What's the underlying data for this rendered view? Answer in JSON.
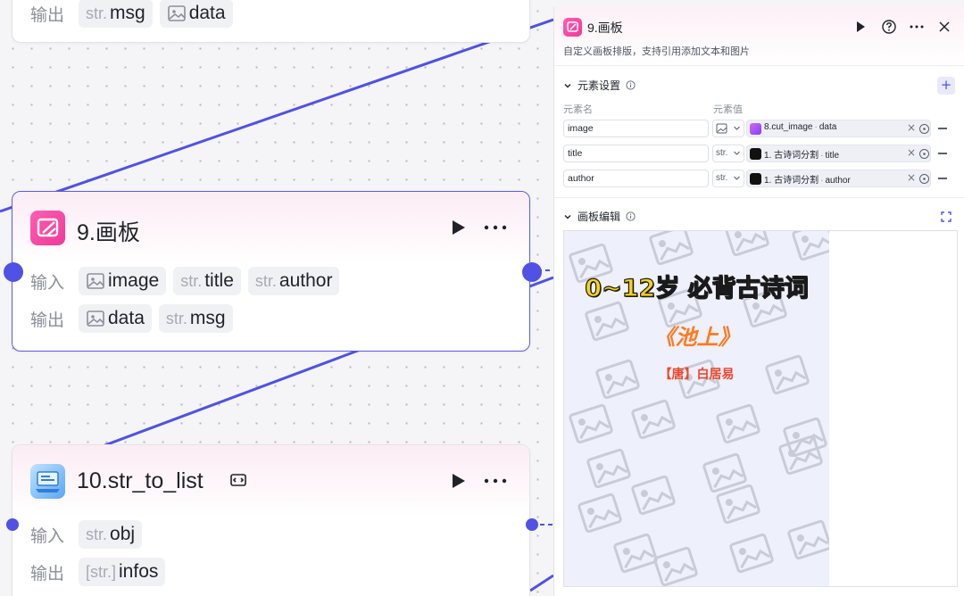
{
  "nodes": {
    "top_partial": {
      "output_label": "输出",
      "outputs": [
        {
          "type": "str.",
          "name": "msg"
        },
        {
          "type": "image",
          "name": "data"
        }
      ]
    },
    "draw": {
      "title": "9.画板",
      "input_label": "输入",
      "output_label": "输出",
      "inputs": [
        {
          "type": "image",
          "name": "image"
        },
        {
          "type": "str.",
          "name": "title"
        },
        {
          "type": "str.",
          "name": "author"
        }
      ],
      "outputs": [
        {
          "type": "image",
          "name": "data"
        },
        {
          "type": "str.",
          "name": "msg"
        }
      ]
    },
    "str_to_list": {
      "title": "10.str_to_list",
      "input_label": "输入",
      "output_label": "输出",
      "inputs": [
        {
          "type": "str.",
          "name": "obj"
        }
      ],
      "outputs": [
        {
          "type": "[str.]",
          "name": "infos"
        }
      ]
    }
  },
  "panel": {
    "title": "9.画板",
    "description": "自定义画板排版，支持引用添加文本和图片",
    "elements_section": "元素设置",
    "col_name": "元素名",
    "col_value": "元素值",
    "add": "+",
    "elements": [
      {
        "name": "image",
        "type": "",
        "source": "8.cut_image",
        "field": "data"
      },
      {
        "name": "title",
        "type": "str.",
        "source": "1. 古诗词分割",
        "field": "title"
      },
      {
        "name": "author",
        "type": "str.",
        "source": "1. 古诗词分割",
        "field": "author"
      }
    ],
    "editor_section": "画板编辑",
    "canvas": {
      "heading": "0~12岁 必背古诗词",
      "poem_title": "《池上》",
      "poem_author": "【唐】白居易"
    }
  },
  "colors": {
    "accent": "#4f52e5",
    "node_icon": "#f0389a",
    "heading_yellow": "#f7d21c",
    "title_orange": "#ff7a1e",
    "author_red": "#f0452b"
  }
}
